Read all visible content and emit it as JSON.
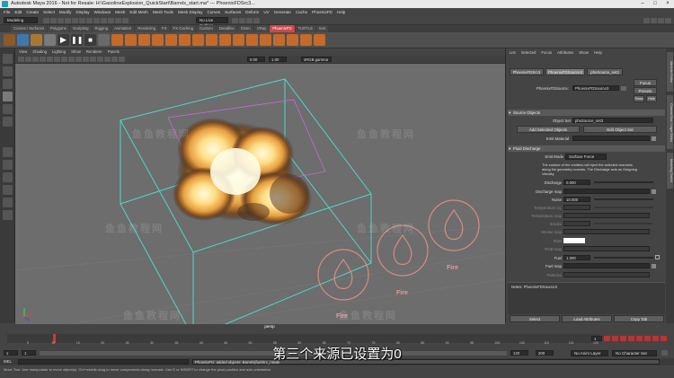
{
  "titlebar": {
    "title": "Autodesk Maya 2016 - Not for Resale: H:\\GasolineExplosion_QuickStart\\Barrels_start.ma*    ---    PhoenixFDSrc3...",
    "controls": [
      "–",
      "□",
      "×"
    ]
  },
  "menubar": {
    "items": [
      "File",
      "Edit",
      "Create",
      "Select",
      "Modify",
      "Display",
      "Windows",
      "Mesh",
      "Edit Mesh",
      "Mesh Tools",
      "Mesh Display",
      "Curves",
      "Surfaces",
      "Deform",
      "UV",
      "Generate",
      "Cache",
      "PhoenixFD",
      "Help"
    ]
  },
  "statusline": {
    "mode": "Modeling",
    "live_surface": "No Live Surface"
  },
  "shelf": {
    "tabs": [
      "Curves / Surfaces",
      "Polygons",
      "Sculpting",
      "Rigging",
      "Animation",
      "Rendering",
      "FX",
      "FX Caching",
      "Custom",
      "Deadline",
      "XGen",
      "VRay",
      "PhoenixFD",
      "TURTLE",
      "test"
    ],
    "active_tab": "PhoenixFD"
  },
  "viewport": {
    "menu": [
      "View",
      "Shading",
      "Lighting",
      "Show",
      "Renderer",
      "Panels"
    ],
    "exposure": "0.00",
    "gamma": "1.00",
    "colorspace": "sRGB gamma",
    "camera_label": "persp",
    "emitter_labels": [
      "Fire",
      "Fire",
      "Fire"
    ]
  },
  "attr": {
    "menu": [
      "List",
      "Selected",
      "Focus",
      "Attributes",
      "Show",
      "Help"
    ],
    "tabs": [
      "PhoenixFDSrc3",
      "PhoenixFDSource3",
      "phxSource_set3"
    ],
    "active_tab": "PhoenixFDSource3",
    "node_label": "PhoenixFDSource:",
    "node_name": "PhoenixFDSource3",
    "buttons_right": [
      "Focus",
      "Presets",
      "Show",
      "Hide"
    ],
    "emitter_label": "Source Objects",
    "object_set_label": "Object Set",
    "object_set_value": "phxSource_set3",
    "add_selected": "Add Selected Objects",
    "edit_set": "Edit Object Set",
    "emit_material_label": "Emit Material",
    "fluid_section": "Fluid Discharge",
    "emit_mode_label": "Emit Mode",
    "emit_mode_value": "Surface Force",
    "description": "The surface of the emitters will eject the selected channels along the geometry normals. The Discharge acts as Outgoing Velocity.",
    "discharge_label": "Discharge",
    "discharge_value": "0.000",
    "discharge_map_label": "Discharge map",
    "noise_label": "Noise",
    "noise_value": "10.000",
    "temp_inj_label": "Temperature inj.",
    "temp_map_label": "Temperature map",
    "smoke_label": "Smoke",
    "smoke_map_label": "Smoke map",
    "rgb_label": "RGB",
    "rgb_map_label": "RGB map",
    "fuel_label": "Fuel",
    "fuel_value": "1.000",
    "fuel_map_label": "Fuel map",
    "particles_label": "Particles",
    "notes_label": "Notes: PhoenixFDSource3",
    "bottom_buttons": [
      "Select",
      "Load Attributes",
      "Copy Tab"
    ]
  },
  "rightstrip": {
    "tabs": [
      "Attribute Editor",
      "Channel Box / Layer Editor",
      "Modeling Toolkit"
    ]
  },
  "timeline": {
    "ticks": [
      "5",
      "10",
      "15",
      "20",
      "25",
      "30",
      "35",
      "40",
      "45",
      "50",
      "55",
      "60",
      "65",
      "70",
      "75",
      "80",
      "85",
      "90",
      "95",
      "100",
      "105",
      "110",
      "115",
      "120"
    ],
    "current_frame": "1"
  },
  "range": {
    "start": "1",
    "start_anim": "1",
    "end": "120",
    "end_anim": "200",
    "anim_layer": "No Anim Layer",
    "char_set": "No Character Set"
  },
  "cmdline": {
    "lang": "MEL",
    "result": "PhoenixFD: added objects: Barrels|fuelSrc_rotate"
  },
  "helpline": {
    "text": "Move Tool: Use manipulator to move object(s). Ctrl+middle-drag to move components along normals. Use D or INSERT to change the pivot position and axis orientation."
  },
  "subtitle": "第三个来源已设置为0",
  "watermark": "鱼鱼教程网"
}
